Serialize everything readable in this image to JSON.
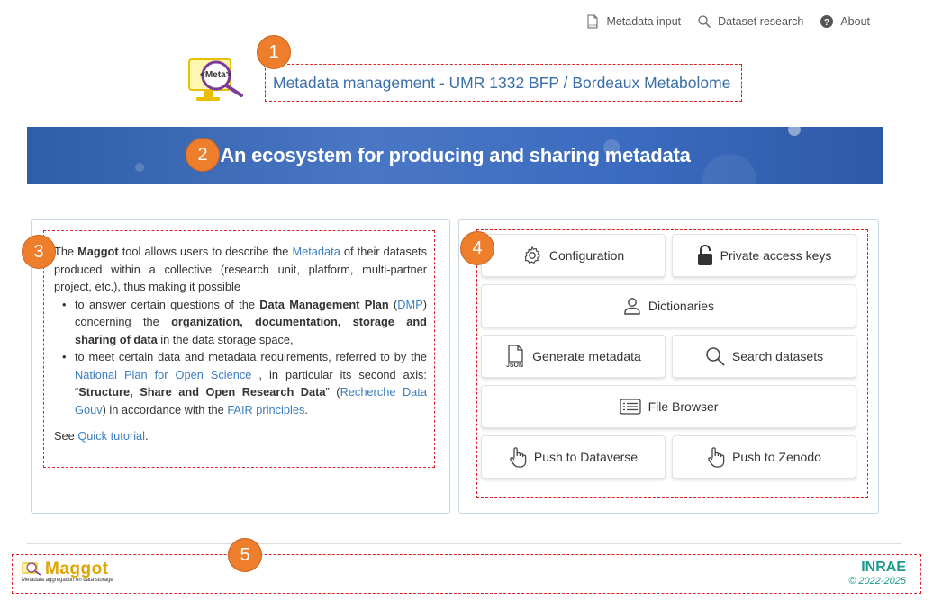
{
  "nav": {
    "items": [
      {
        "label": "Metadata input",
        "icon": "json-file-icon"
      },
      {
        "label": "Dataset research",
        "icon": "search-icon"
      },
      {
        "label": "About",
        "icon": "help-icon"
      }
    ]
  },
  "header": {
    "logo_text": "<Meta>",
    "title": "Metadata management - UMR 1332 BFP / Bordeaux Metabolome"
  },
  "banner": {
    "title": "An ecosystem for producing and sharing metadata"
  },
  "badges": [
    "1",
    "2",
    "3",
    "4",
    "5"
  ],
  "intro": {
    "p1_pre": "The ",
    "p1_maggot": "Maggot",
    "p1_mid": " tool allows users to describe the ",
    "p1_link": "Metadata",
    "p1_post": " of their datasets produced within a collective (research unit, platform, multi-partner project, etc.), thus making it possible",
    "b1_pre": "to answer certain questions of the ",
    "b1_bold1": "Data Management Plan",
    "b1_open": " (",
    "b1_link": "DMP",
    "b1_close": ")",
    "b1_mid": " concerning the ",
    "b1_bold2": "organization, documentation, storage and sharing of data",
    "b1_post": " in the data storage space,",
    "b2_pre": "to meet certain data and metadata requirements, referred to by the ",
    "b2_link1": "National Plan for Open Science",
    "b2_mid": " , in particular its second axis: “",
    "b2_bold": "Structure, Share and Open Research Data",
    "b2_mid2": "” (",
    "b2_link2": "Recherche Data Gouv",
    "b2_mid3": ") in accordance with the ",
    "b2_link3": "FAIR principles",
    "b2_end": ".",
    "see_pre": "See ",
    "see_link": "Quick tutorial",
    "see_end": "."
  },
  "buttons": {
    "configuration": "Configuration",
    "private_keys": "Private access keys",
    "dictionaries": "Dictionaries",
    "generate": "Generate metadata",
    "search": "Search datasets",
    "file_browser": "File Browser",
    "dataverse": "Push to Dataverse",
    "zenodo": "Push to Zenodo"
  },
  "footer": {
    "maggot": "Maggot",
    "maggot_tagline": "Metadata aggregation on data storage",
    "inrae": "INRAE",
    "copyright": "© 2022-2025"
  },
  "colors": {
    "accent": "#3a6fa8",
    "badge": "#ee7d2c",
    "annotation": "#dd2222",
    "inrae": "#1a9a8c"
  }
}
